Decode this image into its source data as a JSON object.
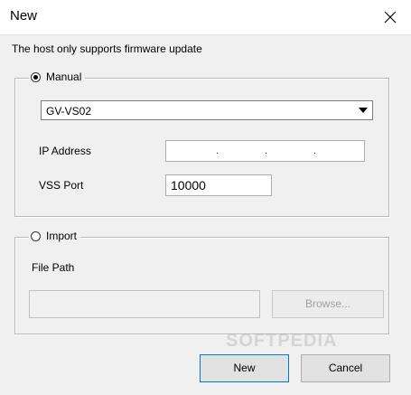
{
  "window": {
    "title": "New"
  },
  "info_text": "The host only supports firmware update",
  "manual_group": {
    "label": "Manual",
    "selected": true,
    "model_value": "GV-VS02",
    "ip_label": "IP Address",
    "ip_separator": ".",
    "port_label": "VSS Port",
    "port_value": "10000"
  },
  "import_group": {
    "label": "Import",
    "selected": false,
    "file_path_label": "File Path",
    "file_path_value": "",
    "browse_label": "Browse..."
  },
  "buttons": {
    "ok_label": "New",
    "cancel_label": "Cancel"
  },
  "watermark": "SOFTPEDIA",
  "icons": {
    "close": "close-icon",
    "dropdown": "chevron-down-icon"
  }
}
